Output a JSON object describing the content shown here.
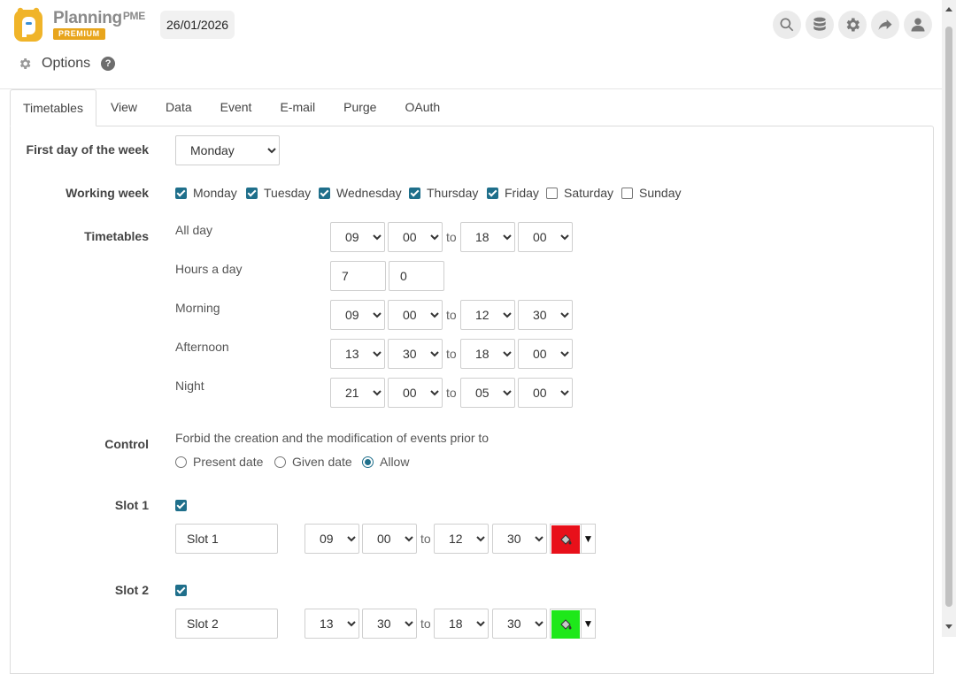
{
  "brand": {
    "name": "Planning",
    "suffix": "PME",
    "badge": "PREMIUM"
  },
  "header": {
    "date": "26/01/2026",
    "icons": [
      "search-icon",
      "database-icon",
      "gear-icon",
      "share-icon",
      "user-icon"
    ]
  },
  "page": {
    "title": "Options",
    "help": "?"
  },
  "tabs": [
    {
      "label": "Timetables",
      "active": true
    },
    {
      "label": "View"
    },
    {
      "label": "Data"
    },
    {
      "label": "Event"
    },
    {
      "label": "E-mail"
    },
    {
      "label": "Purge"
    },
    {
      "label": "OAuth"
    }
  ],
  "form": {
    "first_day": {
      "label": "First day of the week",
      "value": "Monday"
    },
    "working_week": {
      "label": "Working week",
      "days": [
        {
          "label": "Monday",
          "checked": true
        },
        {
          "label": "Tuesday",
          "checked": true
        },
        {
          "label": "Wednesday",
          "checked": true
        },
        {
          "label": "Thursday",
          "checked": true
        },
        {
          "label": "Friday",
          "checked": true
        },
        {
          "label": "Saturday",
          "checked": false
        },
        {
          "label": "Sunday",
          "checked": false
        }
      ]
    },
    "timetables": {
      "label": "Timetables",
      "to": "to",
      "all_day": {
        "label": "All day",
        "from_h": "09",
        "from_m": "00",
        "to_h": "18",
        "to_m": "00"
      },
      "hours_a_day": {
        "label": "Hours a day",
        "hours": "7",
        "minutes": "0"
      },
      "morning": {
        "label": "Morning",
        "from_h": "09",
        "from_m": "00",
        "to_h": "12",
        "to_m": "30"
      },
      "afternoon": {
        "label": "Afternoon",
        "from_h": "13",
        "from_m": "30",
        "to_h": "18",
        "to_m": "00"
      },
      "night": {
        "label": "Night",
        "from_h": "21",
        "from_m": "00",
        "to_h": "05",
        "to_m": "00"
      }
    },
    "control": {
      "label": "Control",
      "description": "Forbid the creation and the modification of events prior to",
      "options": [
        {
          "label": "Present date",
          "selected": false
        },
        {
          "label": "Given date",
          "selected": false
        },
        {
          "label": "Allow",
          "selected": true
        }
      ]
    },
    "slots": [
      {
        "label": "Slot 1",
        "enabled": true,
        "name": "Slot 1",
        "from_h": "09",
        "from_m": "00",
        "to_h": "12",
        "to_m": "30",
        "color": "#e8101a"
      },
      {
        "label": "Slot 2",
        "enabled": true,
        "name": "Slot 2",
        "from_h": "13",
        "from_m": "30",
        "to_h": "18",
        "to_m": "30",
        "color": "#1ee81a"
      }
    ]
  }
}
